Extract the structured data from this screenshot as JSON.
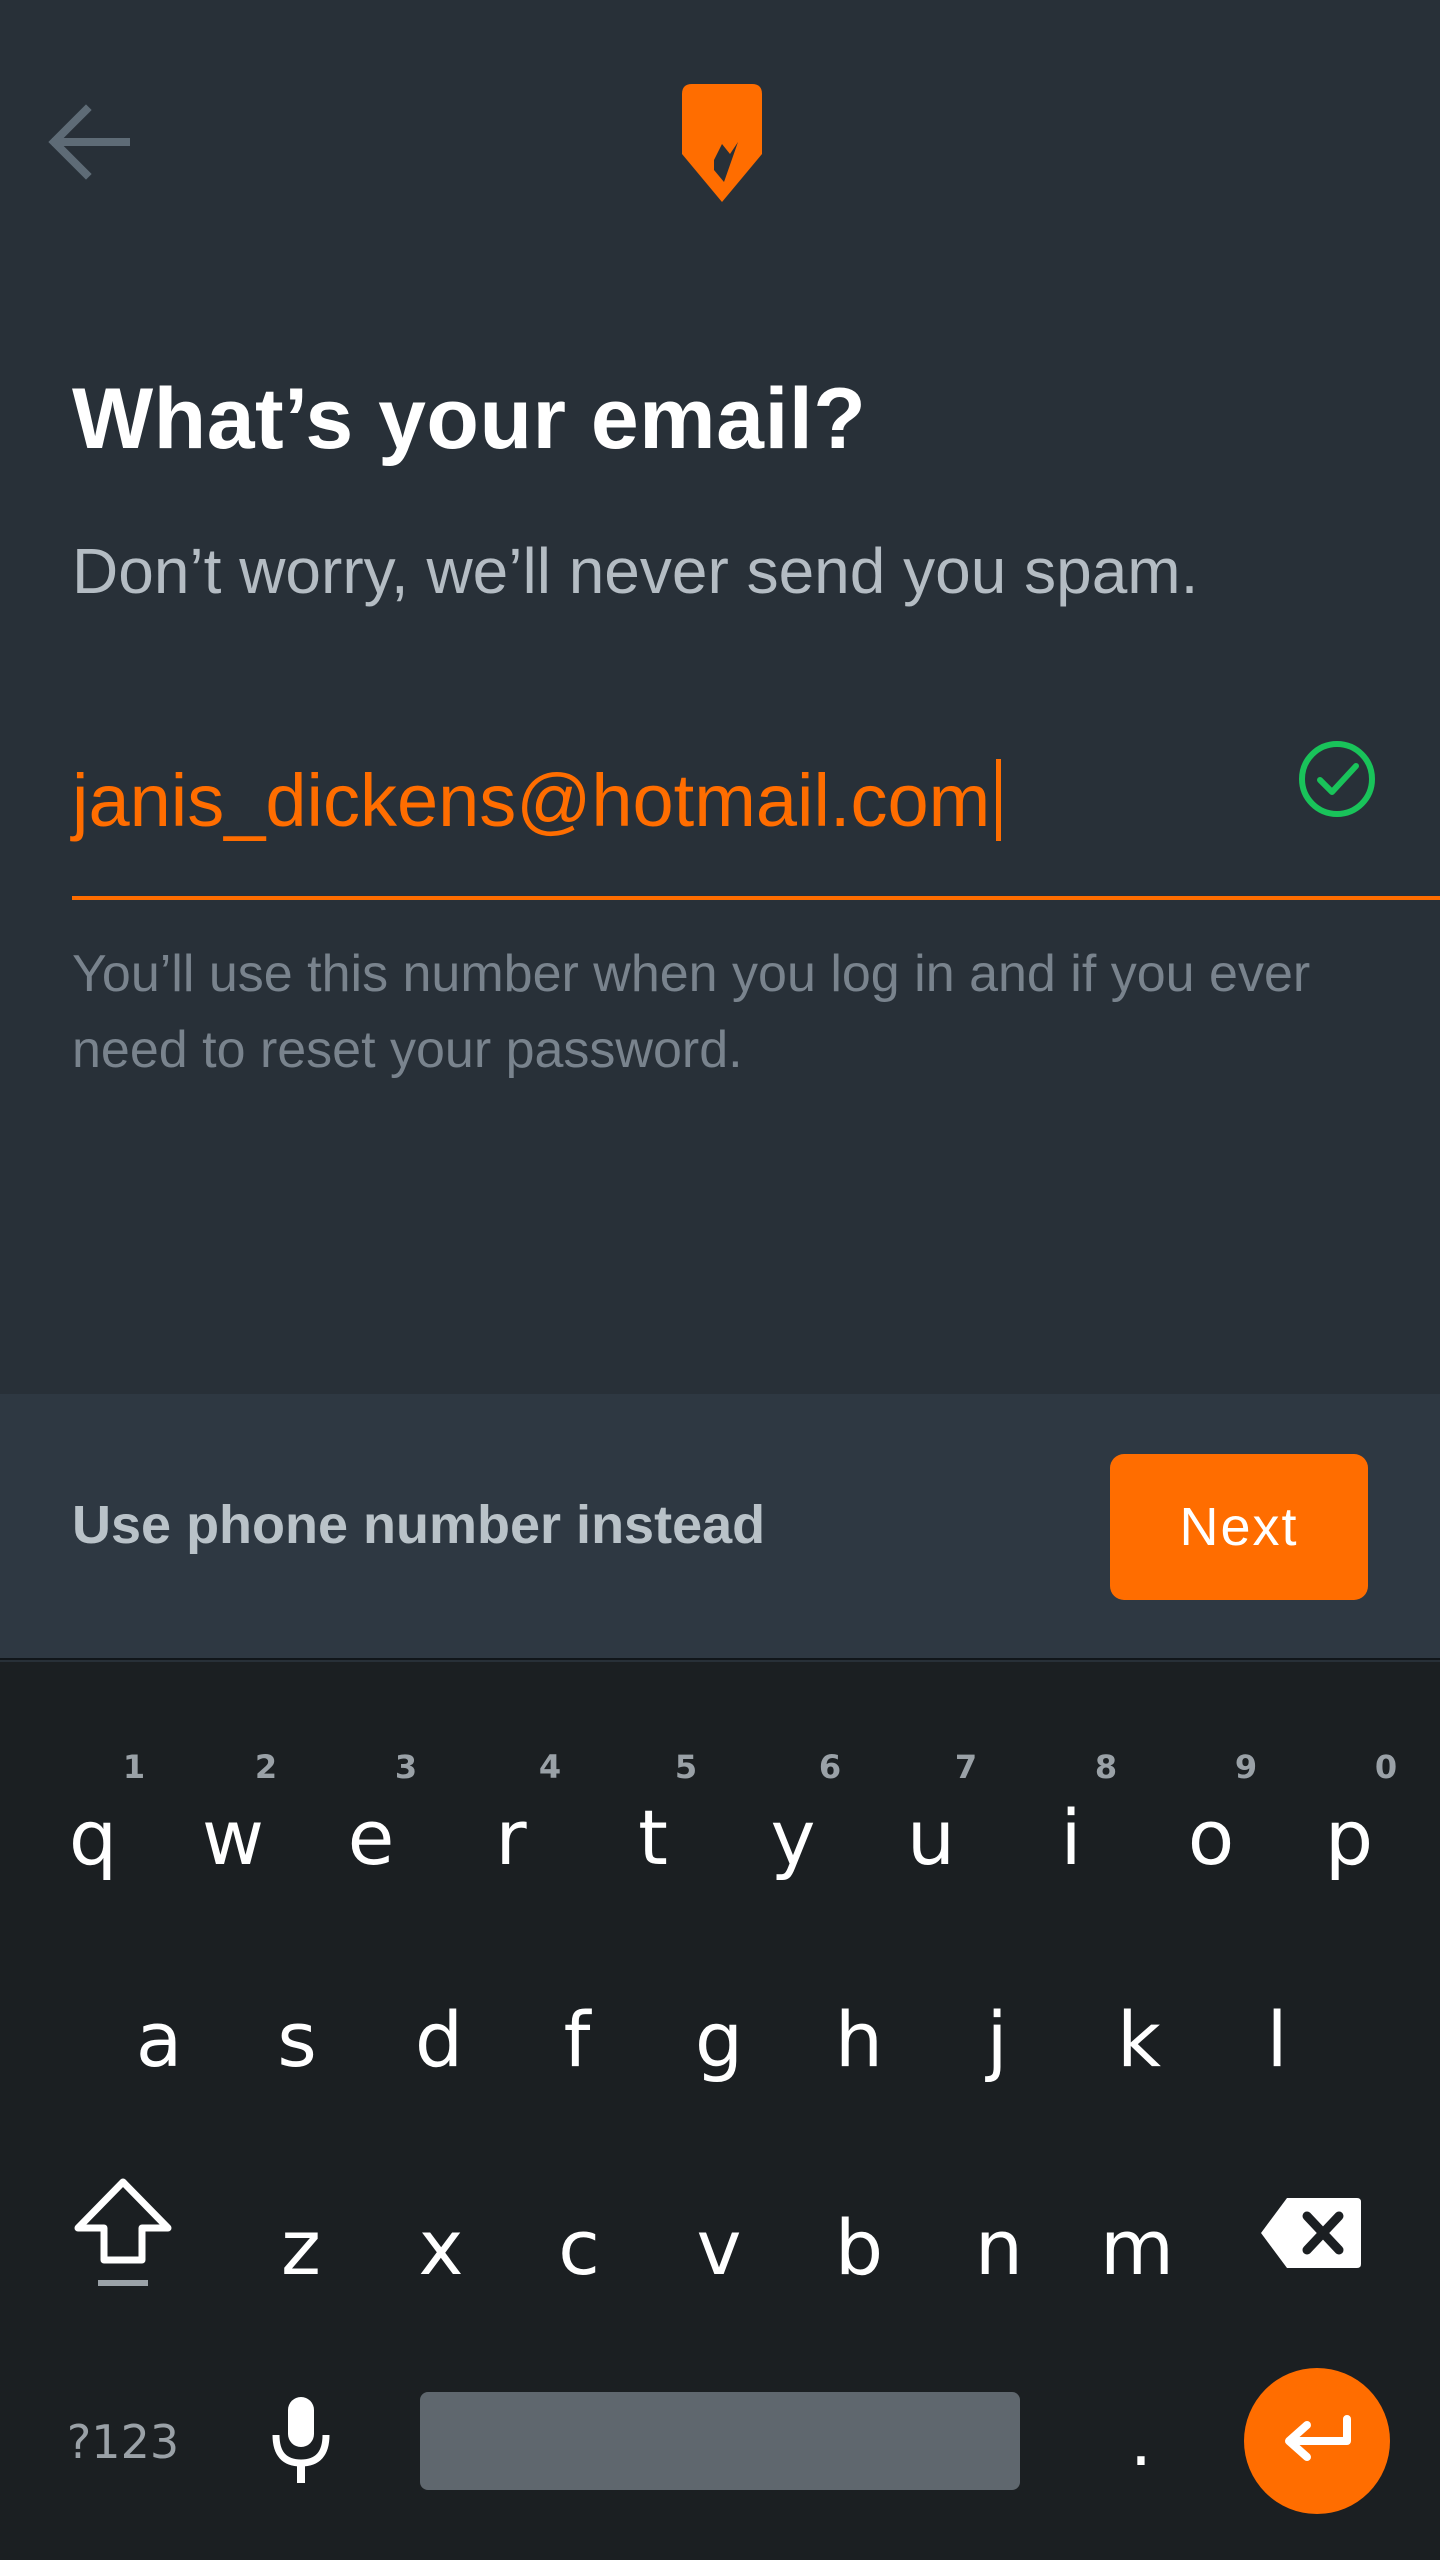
{
  "header": {
    "back_icon": "arrow-left-icon",
    "logo_icon": "brand-shield-logo"
  },
  "main": {
    "title": "What’s your email?",
    "subtitle": "Don’t worry, we’ll never send you spam.",
    "email_value": "janis_dickens@hotmail.com",
    "valid_icon": "check-circle-icon",
    "helper_text": "You’ll use this number when you log in and if you ever need to reset your password."
  },
  "actions": {
    "alt_label": "Use phone number instead",
    "next_label": "Next"
  },
  "keyboard": {
    "row1": [
      "q",
      "w",
      "e",
      "r",
      "t",
      "y",
      "u",
      "i",
      "o",
      "p"
    ],
    "hints": [
      "1",
      "2",
      "3",
      "4",
      "5",
      "6",
      "7",
      "8",
      "9",
      "0"
    ],
    "row2": [
      "a",
      "s",
      "d",
      "f",
      "g",
      "h",
      "j",
      "k",
      "l"
    ],
    "row3": [
      "z",
      "x",
      "c",
      "v",
      "b",
      "n",
      "m"
    ],
    "sym_label": "?123",
    "period_label": ".",
    "shift_icon": "shift-icon",
    "backspace_icon": "backspace-icon",
    "mic_icon": "microphone-icon",
    "enter_icon": "enter-icon"
  },
  "colors": {
    "accent": "#ff6d00",
    "background": "#283038",
    "valid": "#19c35a",
    "keyboard_bg": "#1b1f22"
  }
}
